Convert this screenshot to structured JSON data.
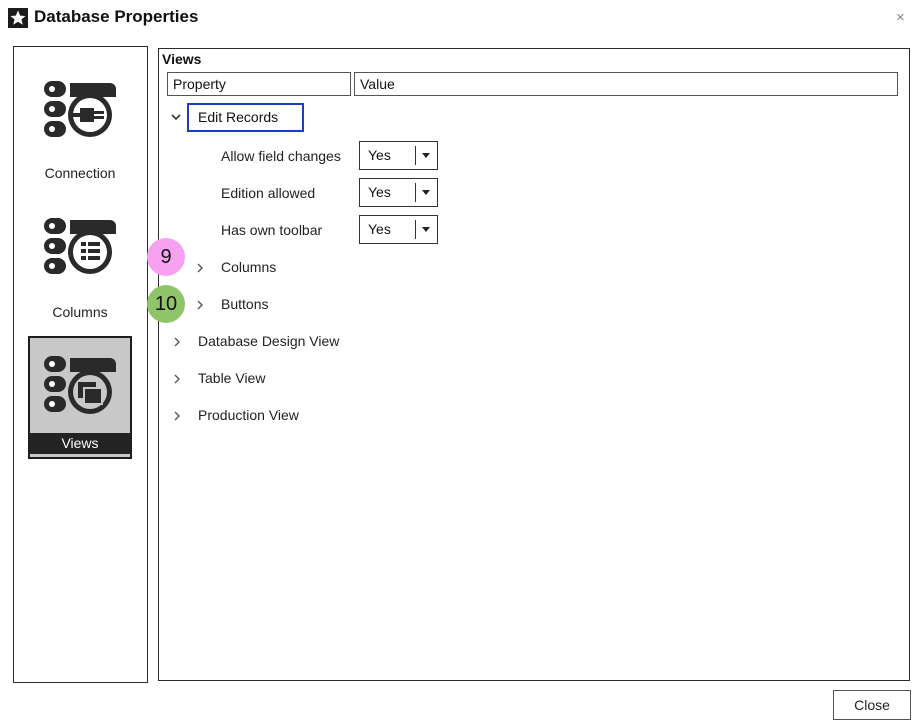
{
  "window": {
    "title": "Database Properties",
    "close_glyph": "×"
  },
  "sidebar": {
    "items": [
      {
        "label": "Connection",
        "icon": "connection-plug-icon"
      },
      {
        "label": "Columns",
        "icon": "columns-list-icon"
      },
      {
        "label": "Views",
        "icon": "views-windows-icon",
        "active": true
      }
    ]
  },
  "panel": {
    "group_title": "Views",
    "headers": {
      "property": "Property",
      "value": "Value"
    },
    "tree": {
      "edit_records": {
        "label": "Edit Records",
        "properties": [
          {
            "label": "Allow field changes",
            "value": "Yes"
          },
          {
            "label": "Edition allowed",
            "value": "Yes"
          },
          {
            "label": "Has own toolbar",
            "value": "Yes"
          }
        ],
        "children": [
          {
            "label": "Columns",
            "badge": "9",
            "badge_color": "#f7a1f0"
          },
          {
            "label": "Buttons",
            "badge": "10",
            "badge_color": "#8fc46a"
          }
        ]
      },
      "others": [
        {
          "label": "Database Design View"
        },
        {
          "label": "Table View"
        },
        {
          "label": "Production View"
        }
      ]
    }
  },
  "footer": {
    "close_label": "Close"
  },
  "colors": {
    "selection_border": "#1a3fb8",
    "active_bg": "#c8c8c8",
    "active_label_bg": "#232323"
  }
}
